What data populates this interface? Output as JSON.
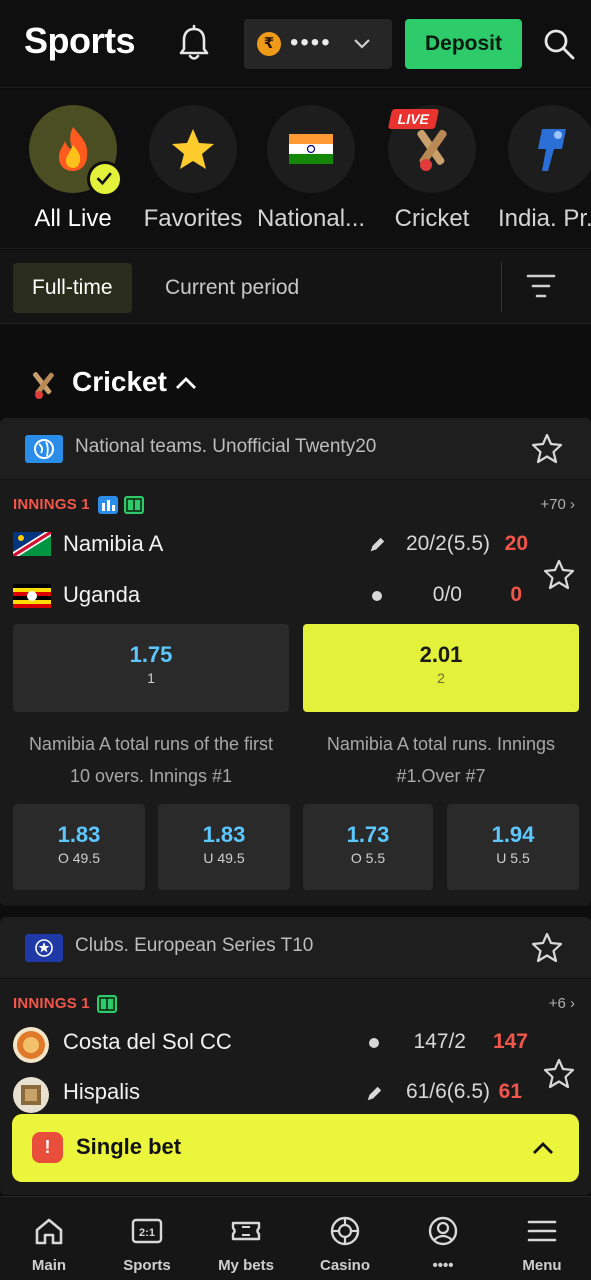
{
  "header": {
    "title": "Sports",
    "balance_mask": "••••",
    "deposit_label": "Deposit",
    "currency_symbol": "₹"
  },
  "categories": [
    {
      "label": "All Live",
      "icon": "fire-icon",
      "active": true
    },
    {
      "label": "Favorites",
      "icon": "star-icon"
    },
    {
      "label": "National...",
      "icon": "india-flag-icon"
    },
    {
      "label": "Cricket",
      "icon": "cricket-icon",
      "badge": "LIVE"
    },
    {
      "label": "India. Pr...",
      "icon": "ipl-logo-icon"
    }
  ],
  "filters": {
    "full_time": "Full-time",
    "current_period": "Current period"
  },
  "section": {
    "title": "Cricket"
  },
  "matches": [
    {
      "league": "National teams. Unofficial Twenty20",
      "status": "INNINGS 1",
      "more": "+70",
      "teams": [
        {
          "name": "Namibia A",
          "score": "20/2(5.5)",
          "runs": "20"
        },
        {
          "name": "Uganda",
          "score": "0/0",
          "runs": "0"
        }
      ],
      "main_odds": [
        {
          "value": "1.75",
          "sub": "1"
        },
        {
          "value": "2.01",
          "sub": "2"
        }
      ],
      "markets": [
        {
          "title": "Namibia A total runs of the first 10 overs. Innings #1",
          "odds": [
            {
              "value": "1.83",
              "sub": "O 49.5"
            },
            {
              "value": "1.83",
              "sub": "U 49.5"
            }
          ]
        },
        {
          "title": "Namibia A total runs. Innings #1.Over #7",
          "odds": [
            {
              "value": "1.73",
              "sub": "O 5.5"
            },
            {
              "value": "1.94",
              "sub": "U 5.5"
            }
          ]
        }
      ]
    },
    {
      "league": "Clubs. European Series T10",
      "status": "INNINGS 1",
      "more": "+6",
      "teams": [
        {
          "name": "Costa del Sol CC",
          "score": "147/2",
          "runs": "147"
        },
        {
          "name": "Hispalis",
          "score": "61/6(6.5)",
          "runs": "61"
        }
      ]
    }
  ],
  "betslip": {
    "label": "Single bet"
  },
  "nav": [
    {
      "label": "Main",
      "icon": "home-icon"
    },
    {
      "label": "Sports",
      "icon": "scoreboard-icon"
    },
    {
      "label": "My bets",
      "icon": "ticket-icon"
    },
    {
      "label": "Casino",
      "icon": "chip-icon"
    },
    {
      "label": "••••",
      "icon": "profile-icon"
    },
    {
      "label": "Menu",
      "icon": "menu-icon"
    }
  ],
  "colors": {
    "accent": "#e4f13a",
    "deposit": "#2ecb6a",
    "live_red": "#f2564b",
    "odds_blue": "#5cc8ff"
  }
}
